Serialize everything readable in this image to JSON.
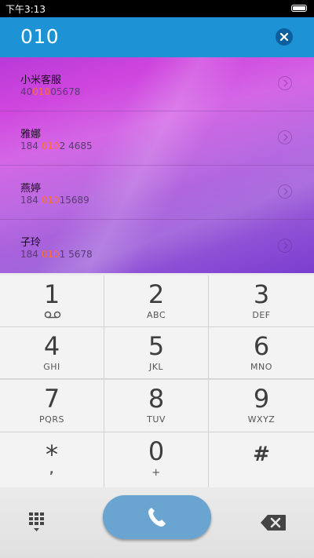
{
  "status_bar": {
    "time": "下午3:13"
  },
  "header": {
    "dialed_number": "010"
  },
  "results": [
    {
      "name": "小米客服",
      "number_parts": [
        "40",
        "010",
        "05678"
      ]
    },
    {
      "name": "雅娜",
      "number_parts": [
        "184 ",
        "010",
        "2 4685"
      ]
    },
    {
      "name": "燕婷",
      "number_parts": [
        "184 ",
        "010",
        "15689"
      ]
    },
    {
      "name": "子玲",
      "number_parts": [
        "184 ",
        "010",
        "1 5678"
      ]
    }
  ],
  "keypad": {
    "keys": [
      {
        "digit": "1",
        "letters": ""
      },
      {
        "digit": "2",
        "letters": "ABC"
      },
      {
        "digit": "3",
        "letters": "DEF"
      },
      {
        "digit": "4",
        "letters": "GHI"
      },
      {
        "digit": "5",
        "letters": "JKL"
      },
      {
        "digit": "6",
        "letters": "MNO"
      },
      {
        "digit": "7",
        "letters": "PQRS"
      },
      {
        "digit": "8",
        "letters": "TUV"
      },
      {
        "digit": "9",
        "letters": "WXYZ"
      },
      {
        "digit": "*",
        "letters": ","
      },
      {
        "digit": "0",
        "letters": "+"
      },
      {
        "digit": "#",
        "letters": ""
      }
    ]
  },
  "icons": {
    "clear": "close-circle-icon",
    "detail": "chevron-right-icon",
    "voicemail": "voicemail-icon",
    "keypad_toggle": "dialpad-icon",
    "call": "phone-icon",
    "backspace": "backspace-icon"
  },
  "colors": {
    "header": "#1d93d6",
    "highlight": "#ff6a3a",
    "call_button": "#6aa5d2"
  }
}
